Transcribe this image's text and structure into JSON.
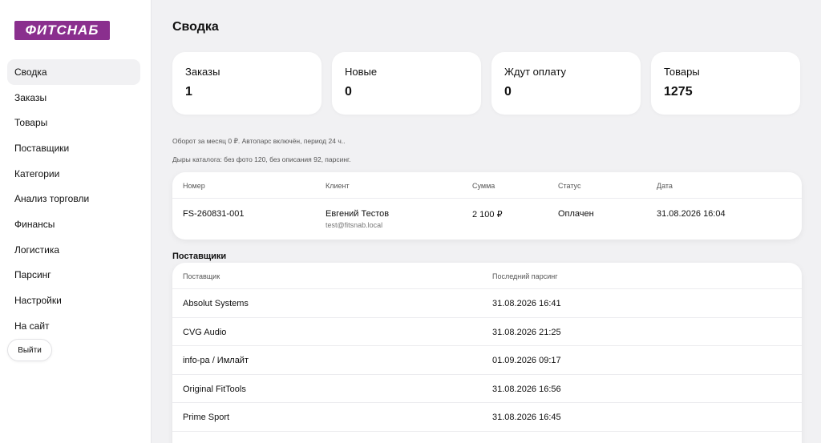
{
  "logo": {
    "text": "ФИТСНАБ"
  },
  "sidebar": {
    "items": [
      {
        "label": "Сводка",
        "active": true
      },
      {
        "label": "Заказы"
      },
      {
        "label": "Товары"
      },
      {
        "label": "Поставщики"
      },
      {
        "label": "Категории"
      },
      {
        "label": "Анализ торговли"
      },
      {
        "label": "Финансы"
      },
      {
        "label": "Логистика"
      },
      {
        "label": "Парсинг"
      },
      {
        "label": "Настройки"
      },
      {
        "label": "На сайт"
      }
    ],
    "logout_label": "Выйти"
  },
  "page": {
    "title": "Сводка"
  },
  "stats": [
    {
      "label": "Заказы",
      "value": "1"
    },
    {
      "label": "Новые",
      "value": "0"
    },
    {
      "label": "Ждут оплату",
      "value": "0"
    },
    {
      "label": "Товары",
      "value": "1275"
    }
  ],
  "info": {
    "line1": "Оборот за месяц 0 ₽. Автопарс включён, период 24 ч..",
    "line2": "Дыры каталога: без фото 120, без описания 92, парсинг."
  },
  "orders": {
    "headers": {
      "number": "Номер",
      "client": "Клиент",
      "sum": "Сумма",
      "status": "Статус",
      "date": "Дата"
    },
    "rows": [
      {
        "number": "FS-260831-001",
        "client_name": "Евгений Тестов",
        "client_email": "test@fitsnab.local",
        "sum": "2 100 ₽",
        "status": "Оплачен",
        "date": "31.08.2026 16:04"
      }
    ]
  },
  "suppliers": {
    "title": "Поставщики",
    "headers": {
      "name": "Поставщик",
      "last_parse": "Последний парсинг"
    },
    "rows": [
      {
        "name": "Absolut Systems",
        "last_parse": "31.08.2026 16:41"
      },
      {
        "name": "CVG Audio",
        "last_parse": "31.08.2026 21:25"
      },
      {
        "name": "info-pa / Имлайт",
        "last_parse": "01.09.2026 09:17"
      },
      {
        "name": "Original FitTools",
        "last_parse": "31.08.2026 16:56"
      },
      {
        "name": "Prime Sport",
        "last_parse": "31.08.2026 16:45"
      }
    ]
  },
  "colors": {
    "brand": "#8a2f8e",
    "background": "#f1f1f3",
    "card": "#ffffff"
  }
}
